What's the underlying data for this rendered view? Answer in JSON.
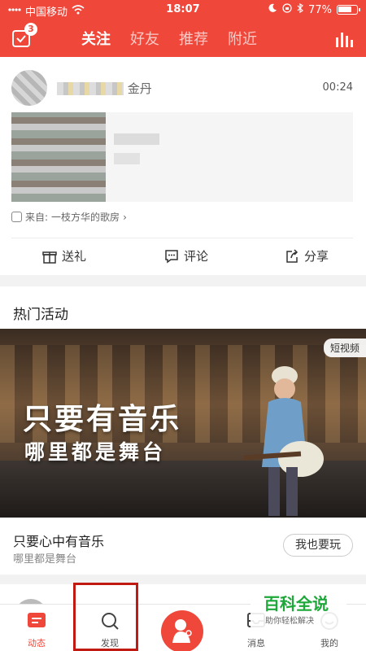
{
  "status_bar": {
    "carrier": "中国移动",
    "time": "18:07",
    "battery_percent": "77%",
    "battery_level": 0.77
  },
  "header": {
    "notification_count": "3",
    "tabs": [
      {
        "label": "关注",
        "active": true
      },
      {
        "label": "好友",
        "active": false
      },
      {
        "label": "推荐",
        "active": false
      },
      {
        "label": "附近",
        "active": false
      }
    ]
  },
  "feed": {
    "username_visible": "金丹",
    "time": "00:24",
    "source_prefix": "来自:",
    "source_name": "一枝方华的歌房",
    "actions": {
      "gift": "送礼",
      "comment": "评论",
      "share": "分享"
    }
  },
  "activity": {
    "section_title": "热门活动",
    "badge": "短视频",
    "banner_line1": "只要有音乐",
    "banner_line2": "哪里都是舞台",
    "title": "只要心中有音乐",
    "subtitle": "哪里都是舞台",
    "button": "我也要玩"
  },
  "bottom_nav": {
    "items": [
      {
        "label": "动态"
      },
      {
        "label": "发现"
      },
      {
        "label": "消息"
      },
      {
        "label": "我的"
      }
    ]
  },
  "watermark": {
    "title": "百科全说",
    "subtitle": "助你轻松解决"
  },
  "colors": {
    "brand": "#f0473b",
    "highlight_border": "#c01a12",
    "watermark_green": "#1ea83a"
  }
}
